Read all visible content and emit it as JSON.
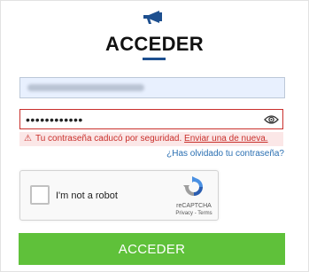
{
  "header": {
    "title": "ACCEDER",
    "logo_icon": "megaphone-icon",
    "accent_color": "#1d4f8f"
  },
  "form": {
    "email_value": "",
    "password_value": "••••••••••••",
    "password_toggle_icon": "eye-icon",
    "error": {
      "icon": "warning-icon",
      "message": "Tu contraseña caducó por seguridad.",
      "link": "Enviar una de nueva.",
      "color": "#c9302c"
    },
    "forgot_link": "¿Has olvidado tu contraseña?",
    "submit_label": "ACCEDER",
    "submit_color": "#5fc13a"
  },
  "recaptcha": {
    "label": "I'm not a robot",
    "brand": "reCAPTCHA",
    "terms": "Privacy - Terms"
  }
}
